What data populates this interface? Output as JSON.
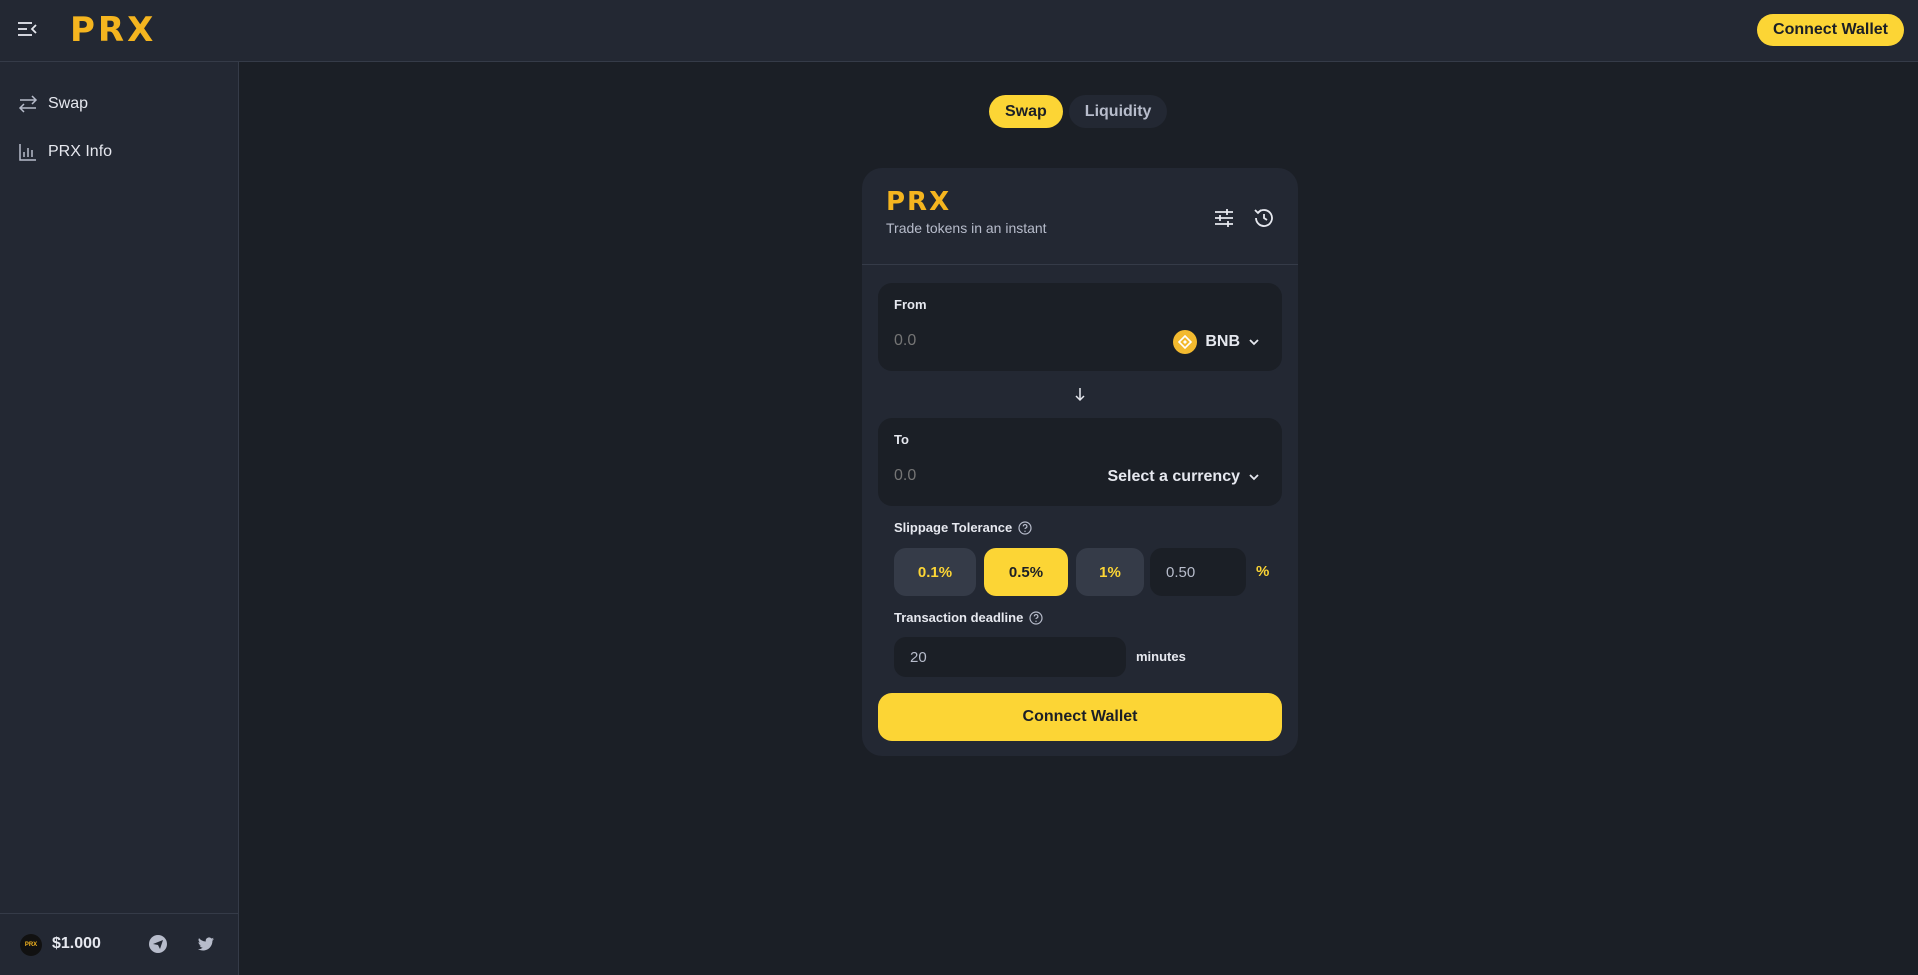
{
  "header": {
    "logo": "PRX",
    "connect_label": "Connect Wallet"
  },
  "sidebar": {
    "items": [
      {
        "label": "Swap",
        "icon": "swap-arrows-icon"
      },
      {
        "label": "PRX Info",
        "icon": "bar-chart-icon"
      }
    ],
    "footer": {
      "coin_logo": "PRX",
      "price": "$1.000",
      "socials": [
        "telegram-icon",
        "twitter-icon"
      ]
    }
  },
  "tabs": {
    "swap": "Swap",
    "liquidity": "Liquidity",
    "active": "Swap"
  },
  "card": {
    "logo": "PRX",
    "subtitle": "Trade tokens in an instant",
    "from": {
      "label": "From",
      "amount_placeholder": "0.0",
      "token": "BNB"
    },
    "to": {
      "label": "To",
      "amount_placeholder": "0.0",
      "token": "Select a currency"
    },
    "slippage": {
      "label": "Slippage Tolerance",
      "options": [
        "0.1%",
        "0.5%",
        "1%"
      ],
      "selected": "0.5%",
      "custom_value": "0.50",
      "unit": "%"
    },
    "deadline": {
      "label": "Transaction deadline",
      "value": "20",
      "unit": "minutes"
    },
    "connect_label": "Connect Wallet"
  },
  "colors": {
    "accent": "#fcd535",
    "brand": "#f5b51f",
    "background": "#1b1f26",
    "panel": "#232833"
  }
}
